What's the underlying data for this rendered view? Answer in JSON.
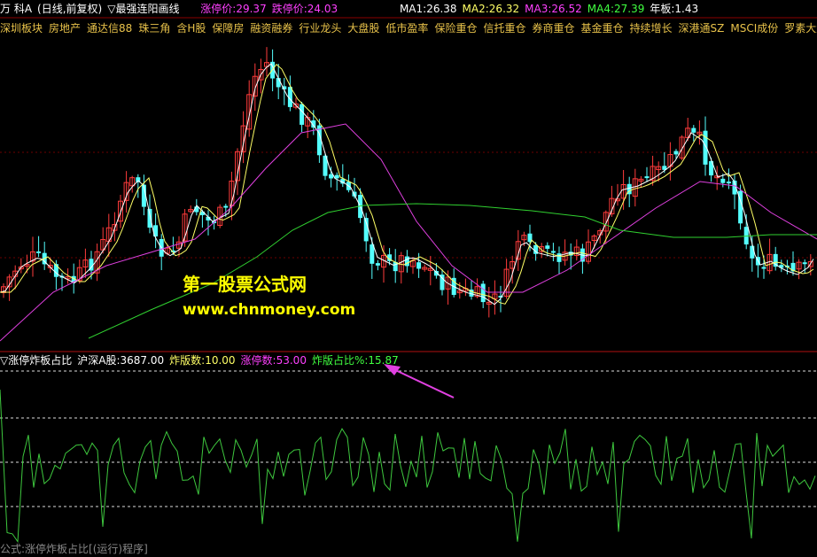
{
  "header": {
    "stock_prefix": "万 科A",
    "period": "(日线,前复权)",
    "indicator_marker": "▽",
    "indicator_name": "最强连阳画线",
    "limit_up_label": "涨停价:",
    "limit_up_value": "29.37",
    "limit_down_label": "跌停价:",
    "limit_down_value": "24.03",
    "ma1_label": "MA1:",
    "ma1_value": "26.38",
    "ma2_label": "MA2:",
    "ma2_value": "26.32",
    "ma3_label": "MA3:",
    "ma3_value": "26.52",
    "ma4_label": "MA4:",
    "ma4_value": "27.39",
    "year_board_label": "年板:",
    "year_board_value": "1.43"
  },
  "tags": [
    "深圳板块",
    "房地产",
    "通达信88",
    "珠三角",
    "含H股",
    "保障房",
    "融资融券",
    "行业龙头",
    "大盘股",
    "低市盈率",
    "保险重仓",
    "信托重仓",
    "券商重仓",
    "基金重仓",
    "持续增长",
    "深港通SZ",
    "MSCI成份",
    "罗素大盘"
  ],
  "watermark": {
    "title": "第一股票公式网",
    "url": "www.chnmoney.com"
  },
  "sub_header": {
    "marker": "▽",
    "name": "涨停炸板占比",
    "index_label": "沪深A股:",
    "index_value": "3687.00",
    "zhaban_label": "炸版数:",
    "zhaban_value": "10.00",
    "zhangting_label": "涨停数:",
    "zhangting_value": "53.00",
    "ratio_label": "炸版占比%:",
    "ratio_value": "15.87"
  },
  "bottom_text": "公式:涨停炸板占比[(运行)程序]",
  "colors": {
    "up": "#ff3b3b",
    "down": "#54ffff",
    "ma_white": "#ffffff",
    "ma_yellow": "#ffff66",
    "ma_magenta": "#e040e0",
    "ma_green": "#30d030",
    "osc_green": "#3ec83e",
    "arrow": "#e040e0",
    "label_white": "#ffffff",
    "label_magenta": "#ff40ff",
    "label_green": "#40ff40"
  },
  "chart_data": {
    "type": "candlestick",
    "ma_labels": [
      "MA1",
      "MA2",
      "MA3",
      "MA4"
    ],
    "oscillator_series_name": "炸版占比%",
    "oscillator_last_value": 15.87
  }
}
